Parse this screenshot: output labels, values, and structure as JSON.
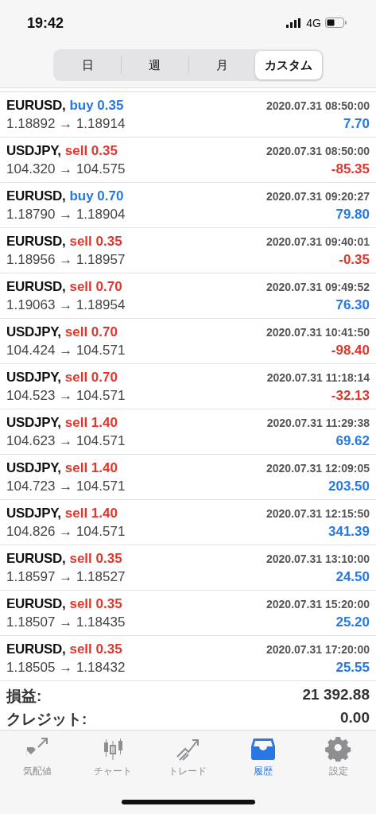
{
  "status_bar": {
    "time": "19:42",
    "network": "4G"
  },
  "period_tabs": [
    {
      "label": "日",
      "selected": false
    },
    {
      "label": "週",
      "selected": false
    },
    {
      "label": "月",
      "selected": false
    },
    {
      "label": "カスタム",
      "selected": true
    }
  ],
  "trades": [
    {
      "symbol": "EURUSD,",
      "kind": "buy",
      "action": "buy 0.35",
      "time": "2020.07.31 08:50:00",
      "prices": "1.18892 → 1.18914",
      "profit": "7.70",
      "color": "#2878e4"
    },
    {
      "symbol": "USDJPY,",
      "kind": "sell",
      "action": "sell 0.35",
      "time": "2020.07.31 08:50:00",
      "prices": "104.320 → 104.575",
      "profit": "-85.35",
      "color": "#e0362c"
    },
    {
      "symbol": "EURUSD,",
      "kind": "buy",
      "action": "buy 0.70",
      "time": "2020.07.31 09:20:27",
      "prices": "1.18790 → 1.18904",
      "profit": "79.80",
      "color": "#2878e4"
    },
    {
      "symbol": "EURUSD,",
      "kind": "sell",
      "action": "sell 0.35",
      "time": "2020.07.31 09:40:01",
      "prices": "1.18956 → 1.18957",
      "profit": "-0.35",
      "color": "#e0362c"
    },
    {
      "symbol": "EURUSD,",
      "kind": "sell",
      "action": "sell 0.70",
      "time": "2020.07.31 09:49:52",
      "prices": "1.19063 → 1.18954",
      "profit": "76.30",
      "color": "#2878e4"
    },
    {
      "symbol": "USDJPY,",
      "kind": "sell",
      "action": "sell 0.70",
      "time": "2020.07.31 10:41:50",
      "prices": "104.424 → 104.571",
      "profit": "-98.40",
      "color": "#e0362c"
    },
    {
      "symbol": "USDJPY,",
      "kind": "sell",
      "action": "sell 0.70",
      "time": "2020.07.31 11:18:14",
      "prices": "104.523 → 104.571",
      "profit": "-32.13",
      "color": "#e0362c"
    },
    {
      "symbol": "USDJPY,",
      "kind": "sell",
      "action": "sell 1.40",
      "time": "2020.07.31 11:29:38",
      "prices": "104.623 → 104.571",
      "profit": "69.62",
      "color": "#2878e4"
    },
    {
      "symbol": "USDJPY,",
      "kind": "sell",
      "action": "sell 1.40",
      "time": "2020.07.31 12:09:05",
      "prices": "104.723 → 104.571",
      "profit": "203.50",
      "color": "#2878e4"
    },
    {
      "symbol": "USDJPY,",
      "kind": "sell",
      "action": "sell 1.40",
      "time": "2020.07.31 12:15:50",
      "prices": "104.826 → 104.571",
      "profit": "341.39",
      "color": "#2878e4"
    },
    {
      "symbol": "EURUSD,",
      "kind": "sell",
      "action": "sell 0.35",
      "time": "2020.07.31 13:10:00",
      "prices": "1.18597 → 1.18527",
      "profit": "24.50",
      "color": "#2878e4"
    },
    {
      "symbol": "EURUSD,",
      "kind": "sell",
      "action": "sell 0.35",
      "time": "2020.07.31 15:20:00",
      "prices": "1.18507 → 1.18435",
      "profit": "25.20",
      "color": "#2878e4"
    },
    {
      "symbol": "EURUSD,",
      "kind": "sell",
      "action": "sell 0.35",
      "time": "2020.07.31 17:20:00",
      "prices": "1.18505 → 1.18432",
      "profit": "25.55",
      "color": "#2878e4"
    }
  ],
  "summary": [
    {
      "label": "損益:",
      "value": "21 392.88"
    },
    {
      "label": "クレジット:",
      "value": "0.00"
    }
  ],
  "tab_bar": [
    {
      "kind": "quotes",
      "label": "気配値",
      "selected": false
    },
    {
      "kind": "chart",
      "label": "チャート",
      "selected": false
    },
    {
      "kind": "trade",
      "label": "トレード",
      "selected": false
    },
    {
      "kind": "history",
      "label": "履歴",
      "selected": true
    },
    {
      "kind": "settings",
      "label": "設定",
      "selected": false
    }
  ]
}
